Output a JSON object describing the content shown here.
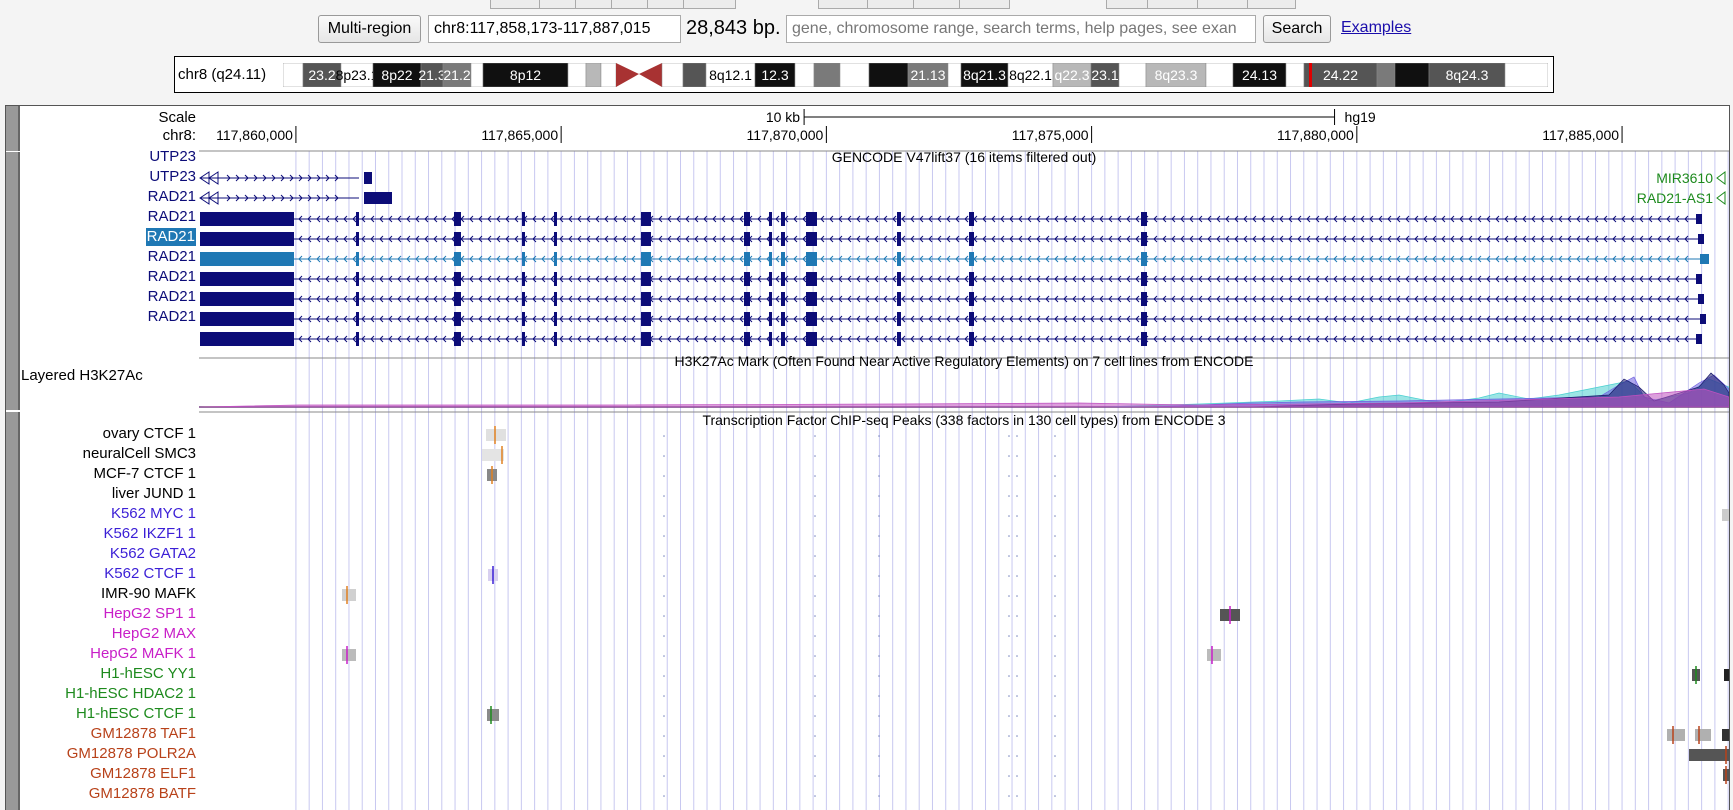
{
  "topbar": {
    "multi_region_label": "Multi-region",
    "position_value": "chr8:117,858,173-117,887,015",
    "size_text": "28,843 bp.",
    "search_placeholder": "gene, chromosome range, search terms, help pages, see exan",
    "search_label": "Search",
    "examples_link": "Examples"
  },
  "ideogram": {
    "label": "chr8 (q24.11)",
    "bands": [
      "23.2",
      "8p23.1",
      "8p22",
      "21.3",
      "21.2",
      "8p12",
      "8q12.1",
      "12.3",
      "21.13",
      "8q21.3",
      "8q22.1",
      "q22.3",
      "23.1",
      "8q23.3",
      "24.13",
      "24.22",
      "8q24.3"
    ],
    "centromere_color": "#a83232",
    "position_marker_color": "#e00000"
  },
  "ruler": {
    "scale_label": "Scale",
    "chrom_label": "chr8:",
    "scale_bar_text": "10 kb",
    "assembly": "hg19",
    "ticks": [
      "117,860,000",
      "117,865,000",
      "117,870,000",
      "117,875,000",
      "117,880,000",
      "117,885,000"
    ]
  },
  "tracks": {
    "gencode": {
      "title": "GENCODE V47lift37 (16 items filtered out)",
      "color": "#0c0c78",
      "highlight_color": "#1f78b4",
      "genes": [
        {
          "name": "UTP23"
        },
        {
          "name": "UTP23"
        },
        {
          "name": "RAD21"
        },
        {
          "name": "RAD21"
        },
        {
          "name": "RAD21"
        },
        {
          "name": "RAD21"
        },
        {
          "name": "RAD21"
        },
        {
          "name": "RAD21"
        },
        {
          "name": "RAD21"
        }
      ],
      "right_genes": [
        {
          "name": "MIR3610",
          "color": "#1d8a1d"
        },
        {
          "name": "RAD21-AS1",
          "color": "#1d8a1d"
        }
      ]
    },
    "h3k27ac": {
      "label": "Layered H3K27Ac",
      "title": "H3K27Ac Mark (Often Found Near Active Regulatory Elements) on 7 cell lines from ENCODE"
    },
    "tfbs": {
      "title": "Transcription Factor ChIP-seq Peaks (338 factors in 130 cell types) from ENCODE 3",
      "rows": [
        {
          "label": "ovary CTCF 1",
          "color": "#000000"
        },
        {
          "label": "neuralCell SMC3",
          "color": "#000000"
        },
        {
          "label": "MCF-7 CTCF 1",
          "color": "#000000"
        },
        {
          "label": "liver JUND 1",
          "color": "#000000"
        },
        {
          "label": "K562 MYC 1",
          "color": "#3b1fd6"
        },
        {
          "label": "K562 IKZF1 1",
          "color": "#3b1fd6"
        },
        {
          "label": "K562 GATA2",
          "color": "#3b1fd6"
        },
        {
          "label": "K562 CTCF 1",
          "color": "#3b1fd6"
        },
        {
          "label": "IMR-90 MAFK",
          "color": "#000000"
        },
        {
          "label": "HepG2 SP1 1",
          "color": "#c81ec8"
        },
        {
          "label": "HepG2 MAX",
          "color": "#c81ec8"
        },
        {
          "label": "HepG2 MAFK 1",
          "color": "#c81ec8"
        },
        {
          "label": "H1-hESC YY1",
          "color": "#1d8a1d"
        },
        {
          "label": "H1-hESC HDAC2 1",
          "color": "#1d8a1d"
        },
        {
          "label": "H1-hESC CTCF 1",
          "color": "#1d8a1d"
        },
        {
          "label": "GM12878 TAF1",
          "color": "#b8421a"
        },
        {
          "label": "GM12878 POLR2A",
          "color": "#b8421a"
        },
        {
          "label": "GM12878 ELF1",
          "color": "#b8421a"
        },
        {
          "label": "GM12878 BATF",
          "color": "#b8421a"
        }
      ]
    }
  }
}
